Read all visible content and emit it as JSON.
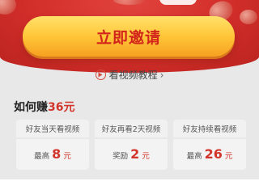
{
  "invite": {
    "label": "立即邀请"
  },
  "tutorial": {
    "label": "看视频教程"
  },
  "earn": {
    "title": "如何赚",
    "amount": "36元"
  },
  "cards": [
    {
      "condition": "好友当天看视频",
      "prefix": "最高",
      "value": "8",
      "unit": "元"
    },
    {
      "condition": "好友再看2天视频",
      "prefix": "奖励",
      "value": "2",
      "unit": "元"
    },
    {
      "condition": "好友持续看视频",
      "prefix": "最高",
      "value": "26",
      "unit": "元"
    }
  ],
  "colors": {
    "banner": "#d22e2a",
    "button": "#ffc638",
    "accent": "#d2342b"
  },
  "icons": {
    "play": "play-circle-icon",
    "chevron": "chevron-right-icon"
  }
}
